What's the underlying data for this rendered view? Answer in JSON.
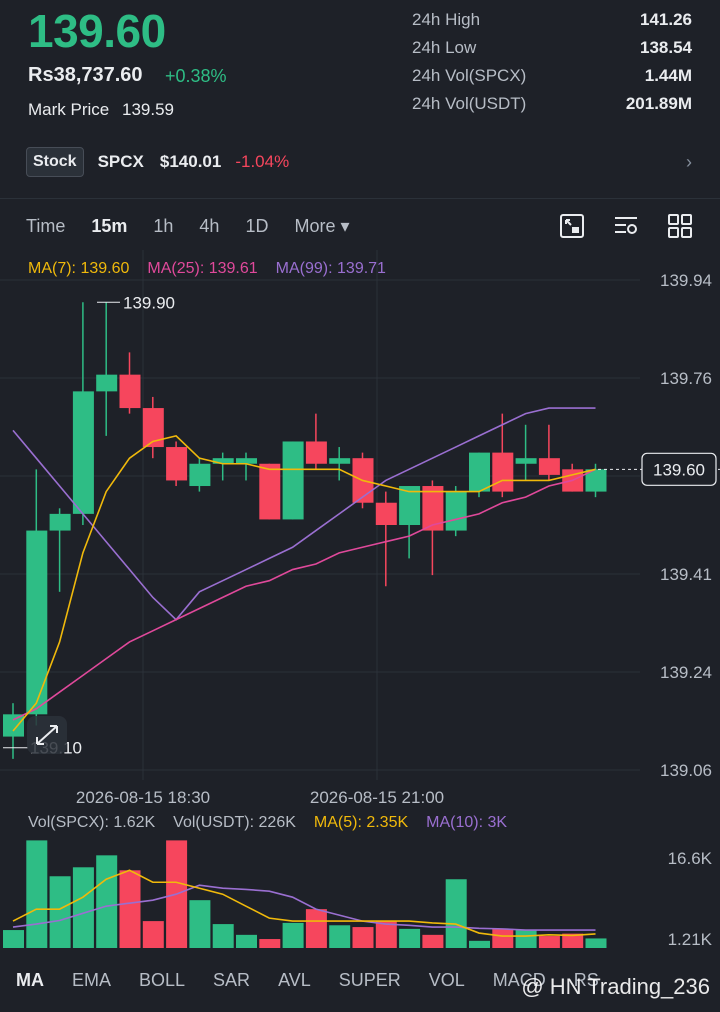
{
  "header": {
    "last_price": "139.60",
    "fiat_price": "Rs38,737.60",
    "change_pct": "+0.38%",
    "mark_price_label": "Mark Price",
    "mark_price": "139.59"
  },
  "stats": [
    {
      "label": "24h High",
      "value": "141.26"
    },
    {
      "label": "24h Low",
      "value": "138.54"
    },
    {
      "label": "24h Vol(SPCX)",
      "value": "1.44M"
    },
    {
      "label": "24h Vol(USDT)",
      "value": "201.89M"
    }
  ],
  "stock": {
    "tag": "Stock",
    "symbol": "SPCX",
    "price": "$140.01",
    "change": "-1.04%",
    "arrow": "›"
  },
  "timeframes": [
    "Time",
    "15m",
    "1h",
    "4h",
    "1D",
    "More ▾"
  ],
  "active_timeframe": "15m",
  "ma_legend": {
    "ma7": "MA(7): 139.60",
    "ma25": "MA(25): 139.61",
    "ma99": "MA(99): 139.71"
  },
  "vol_legend": {
    "vol_base": "Vol(SPCX): 1.62K",
    "vol_quote": "Vol(USDT): 226K",
    "ma5": "MA(5): 2.35K",
    "ma10": "MA(10): 3K"
  },
  "indicators": [
    "MA",
    "EMA",
    "BOLL",
    "SAR",
    "AVL",
    "SUPER",
    "VOL",
    "MACD",
    "RS"
  ],
  "active_indicator": "MA",
  "watermark": "@ HN Trading_236",
  "colors": {
    "up": "#2ebd85",
    "down": "#f6465d",
    "ma7": "#f0b90b",
    "ma25": "#e0499b",
    "ma99": "#9a6fd1",
    "background": "#1e2128"
  },
  "chart_data": {
    "type": "candlestick",
    "y_ticks": [
      "139.94",
      "139.76",
      "139.59",
      "139.41",
      "139.24",
      "139.06"
    ],
    "ylim": [
      139.06,
      139.94
    ],
    "x_tick_labels": [
      "2026-08-15 18:30",
      "2026-08-15 21:00"
    ],
    "current_price_label": "139.60",
    "high_marker": "139.90",
    "low_marker": "139.10",
    "candles": [
      {
        "o": 139.12,
        "h": 139.18,
        "l": 139.08,
        "c": 139.16
      },
      {
        "o": 139.16,
        "h": 139.6,
        "l": 139.14,
        "c": 139.49
      },
      {
        "o": 139.49,
        "h": 139.53,
        "l": 139.38,
        "c": 139.52
      },
      {
        "o": 139.52,
        "h": 139.9,
        "l": 139.5,
        "c": 139.74
      },
      {
        "o": 139.74,
        "h": 139.9,
        "l": 139.66,
        "c": 139.77
      },
      {
        "o": 139.77,
        "h": 139.81,
        "l": 139.7,
        "c": 139.71
      },
      {
        "o": 139.71,
        "h": 139.73,
        "l": 139.62,
        "c": 139.64
      },
      {
        "o": 139.64,
        "h": 139.65,
        "l": 139.57,
        "c": 139.58
      },
      {
        "o": 139.57,
        "h": 139.62,
        "l": 139.56,
        "c": 139.61
      },
      {
        "o": 139.61,
        "h": 139.63,
        "l": 139.58,
        "c": 139.62
      },
      {
        "o": 139.61,
        "h": 139.63,
        "l": 139.58,
        "c": 139.62
      },
      {
        "o": 139.61,
        "h": 139.61,
        "l": 139.51,
        "c": 139.51
      },
      {
        "o": 139.51,
        "h": 139.65,
        "l": 139.51,
        "c": 139.65
      },
      {
        "o": 139.65,
        "h": 139.7,
        "l": 139.6,
        "c": 139.61
      },
      {
        "o": 139.61,
        "h": 139.64,
        "l": 139.58,
        "c": 139.62
      },
      {
        "o": 139.62,
        "h": 139.63,
        "l": 139.53,
        "c": 139.54
      },
      {
        "o": 139.54,
        "h": 139.56,
        "l": 139.39,
        "c": 139.5
      },
      {
        "o": 139.5,
        "h": 139.57,
        "l": 139.44,
        "c": 139.57
      },
      {
        "o": 139.57,
        "h": 139.58,
        "l": 139.41,
        "c": 139.49
      },
      {
        "o": 139.49,
        "h": 139.57,
        "l": 139.48,
        "c": 139.56
      },
      {
        "o": 139.56,
        "h": 139.63,
        "l": 139.55,
        "c": 139.63
      },
      {
        "o": 139.63,
        "h": 139.7,
        "l": 139.55,
        "c": 139.56
      },
      {
        "o": 139.61,
        "h": 139.68,
        "l": 139.58,
        "c": 139.62
      },
      {
        "o": 139.62,
        "h": 139.68,
        "l": 139.58,
        "c": 139.59
      },
      {
        "o": 139.6,
        "h": 139.61,
        "l": 139.56,
        "c": 139.56
      },
      {
        "o": 139.56,
        "h": 139.61,
        "l": 139.55,
        "c": 139.6
      }
    ],
    "ma7": [
      139.13,
      139.18,
      139.29,
      139.45,
      139.56,
      139.62,
      139.65,
      139.66,
      139.62,
      139.61,
      139.61,
      139.6,
      139.6,
      139.6,
      139.6,
      139.58,
      139.57,
      139.56,
      139.56,
      139.56,
      139.56,
      139.58,
      139.58,
      139.58,
      139.59,
      139.6
    ],
    "ma25": [
      139.15,
      139.17,
      139.2,
      139.23,
      139.26,
      139.29,
      139.31,
      139.33,
      139.35,
      139.37,
      139.39,
      139.4,
      139.42,
      139.43,
      139.45,
      139.46,
      139.47,
      139.48,
      139.5,
      139.51,
      139.52,
      139.54,
      139.55,
      139.57,
      139.58,
      139.6
    ],
    "ma99": [
      139.67,
      139.62,
      139.57,
      139.52,
      139.47,
      139.42,
      139.37,
      139.33,
      139.38,
      139.4,
      139.42,
      139.44,
      139.46,
      139.49,
      139.52,
      139.55,
      139.58,
      139.6,
      139.62,
      139.64,
      139.66,
      139.68,
      139.7,
      139.71,
      139.71,
      139.71
    ],
    "volume": {
      "y_ticks": [
        "16.6K",
        "1.21K"
      ],
      "ylim": [
        0,
        18.4
      ],
      "values": [
        3.0,
        18.0,
        12.0,
        13.5,
        15.5,
        13.0,
        4.5,
        18.0,
        8.0,
        4.0,
        2.2,
        1.5,
        4.2,
        6.5,
        3.8,
        3.5,
        4.5,
        3.2,
        2.2,
        11.5,
        1.2,
        3.2,
        3.0,
        2.0,
        2.4,
        1.6
      ],
      "ma5": [
        4.5,
        6.5,
        6.5,
        8.5,
        11.5,
        13,
        11,
        11,
        10,
        9,
        7,
        5,
        4.5,
        4.5,
        4.5,
        4.5,
        4.5,
        4.5,
        4.2,
        4.0,
        2.5,
        2.0,
        2.0,
        2.2,
        2.1,
        2.35
      ],
      "ma10": [
        3.5,
        4.0,
        4.6,
        5.8,
        7.0,
        7.5,
        8.0,
        9.0,
        10.5,
        10.0,
        9.8,
        9.5,
        8.5,
        6.5,
        5.5,
        4.5,
        4.0,
        3.8,
        3.5,
        3.5,
        3.3,
        3.2,
        3.0,
        3.0,
        3.0,
        3.0
      ]
    }
  }
}
